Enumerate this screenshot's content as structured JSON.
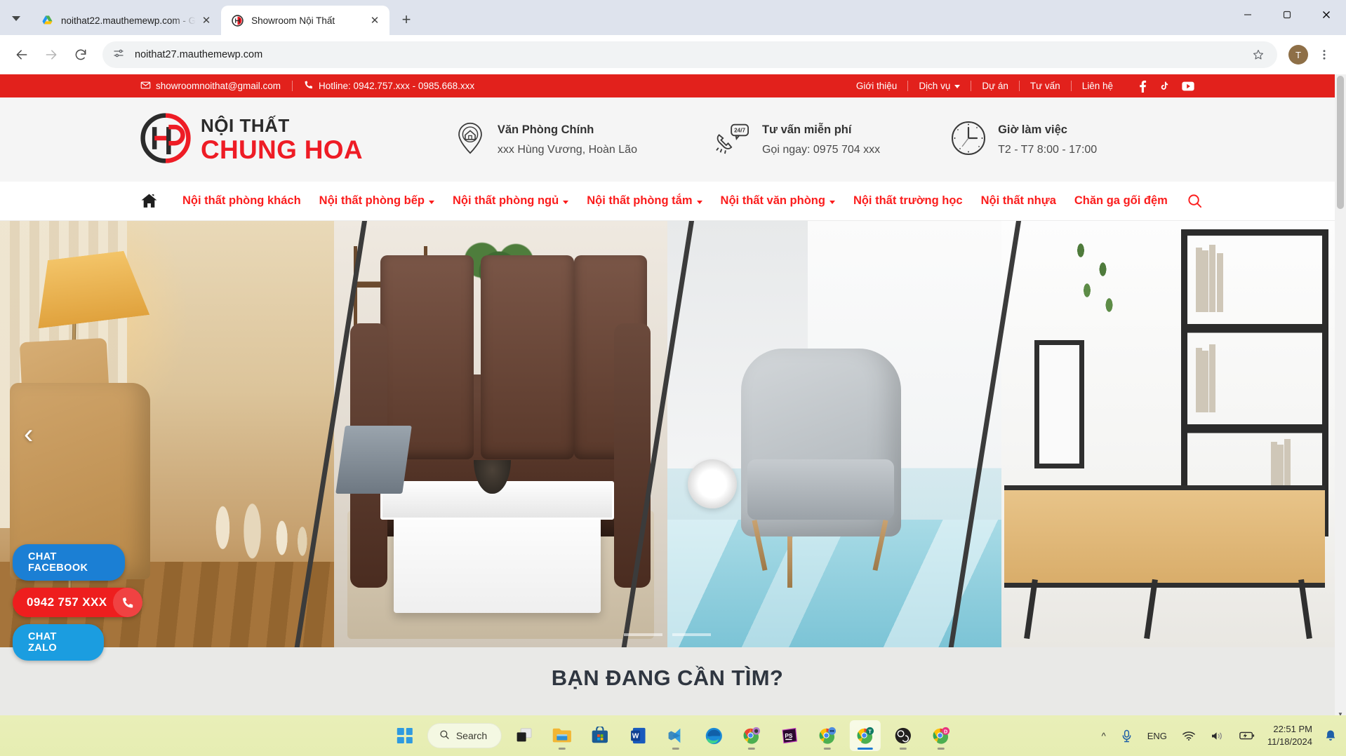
{
  "browser": {
    "tabs": [
      {
        "title": "noithat22.mauthemewp.com - G",
        "favicon": "google-drive-icon",
        "active": false
      },
      {
        "title": "Showroom Nội Thất",
        "favicon": "site-logo-icon",
        "active": true
      }
    ],
    "new_tab_label": "+",
    "window_controls": {
      "minimize": "–",
      "maximize": "▢",
      "close": "✕"
    },
    "toolbar": {
      "back": "←",
      "forward": "→",
      "reload": "⟳",
      "site_info": "tune-icon",
      "url": "noithat27.mauthemewp.com",
      "bookmark": "☆",
      "menu": "⋮",
      "profile_initial": "T"
    }
  },
  "topbar": {
    "email": "showroomnoithat@gmail.com",
    "hotline": "Hotline: 0942.757.xxx - 0985.668.xxx",
    "links": [
      {
        "label": "Giới thiệu",
        "has_caret": false
      },
      {
        "label": "Dịch vụ",
        "has_caret": true
      },
      {
        "label": "Dự án",
        "has_caret": false
      },
      {
        "label": "Tư vấn",
        "has_caret": false
      },
      {
        "label": "Liên hệ",
        "has_caret": false
      }
    ],
    "socials": [
      "facebook-icon",
      "tiktok-icon",
      "youtube-icon"
    ],
    "bg_color": "#e2211c"
  },
  "header": {
    "logo": {
      "line1": "NỘI THẤT",
      "line2": "CHUNG HOA",
      "mark": "hp-monogram-icon"
    },
    "infos": [
      {
        "icon": "location-pin-home-icon",
        "title": "Văn Phòng Chính",
        "subtitle": "xxx Hùng Vương, Hoàn Lão"
      },
      {
        "icon": "phone-24-7-icon",
        "title": "Tư vấn miễn phí",
        "subtitle": "Gọi ngay: 0975 704 xxx"
      },
      {
        "icon": "clock-icon",
        "title": "Giờ làm việc",
        "subtitle": "T2 - T7 8:00 - 17:00"
      }
    ]
  },
  "nav": {
    "home_icon": "home-icon",
    "search_icon": "search-icon",
    "items": [
      {
        "label": "Nội thất phòng khách",
        "has_caret": false
      },
      {
        "label": "Nội thất phòng bếp",
        "has_caret": true
      },
      {
        "label": "Nội thất phòng ngủ",
        "has_caret": true
      },
      {
        "label": "Nội thất phòng tắm",
        "has_caret": true
      },
      {
        "label": "Nội thất văn phòng",
        "has_caret": true
      },
      {
        "label": "Nội thất trường học",
        "has_caret": false
      },
      {
        "label": "Nội thất nhựa",
        "has_caret": false
      },
      {
        "label": "Chăn ga gối đệm",
        "has_caret": false
      }
    ],
    "accent_color": "#fb1c1c"
  },
  "hero": {
    "prev_arrow": "‹",
    "dots": [
      {
        "active": false
      },
      {
        "active": false
      }
    ]
  },
  "section2": {
    "title": "BẠN ĐANG CẦN TÌM?"
  },
  "floats": [
    {
      "name": "chat-facebook",
      "label": "CHAT FACEBOOK",
      "color": "#1b7fd4"
    },
    {
      "name": "hotline",
      "label": "0942 757 XXX",
      "color": "#ee1e1e",
      "icon": "phone-icon"
    },
    {
      "name": "chat-zalo",
      "label": "CHAT ZALO",
      "color": "#1b9de0"
    }
  ],
  "taskbar": {
    "search_placeholder": "Search",
    "apps": [
      {
        "name": "start-windows-icon",
        "running": false
      },
      {
        "name": "task-view-icon",
        "running": false
      },
      {
        "name": "file-explorer-icon",
        "running": true
      },
      {
        "name": "microsoft-store-icon",
        "running": false
      },
      {
        "name": "word-icon",
        "running": false
      },
      {
        "name": "vscode-icon",
        "running": true
      },
      {
        "name": "edge-icon",
        "running": false
      },
      {
        "name": "chrome-profile-1-icon",
        "running": true
      },
      {
        "name": "photoshop-icon",
        "running": false
      },
      {
        "name": "chrome-profile-2-icon",
        "running": true
      },
      {
        "name": "chrome-profile-t-icon",
        "running": true,
        "active": true
      },
      {
        "name": "obs-icon",
        "running": true
      },
      {
        "name": "chrome-profile-d-icon",
        "running": true
      }
    ],
    "system": {
      "chevron": "^",
      "mic": "mic-icon",
      "language": "ENG",
      "wifi": "wifi-icon",
      "volume": "volume-icon",
      "battery": "battery-charging-icon",
      "time": "22:51 PM",
      "date": "11/18/2024",
      "notification": "bell-icon"
    }
  }
}
